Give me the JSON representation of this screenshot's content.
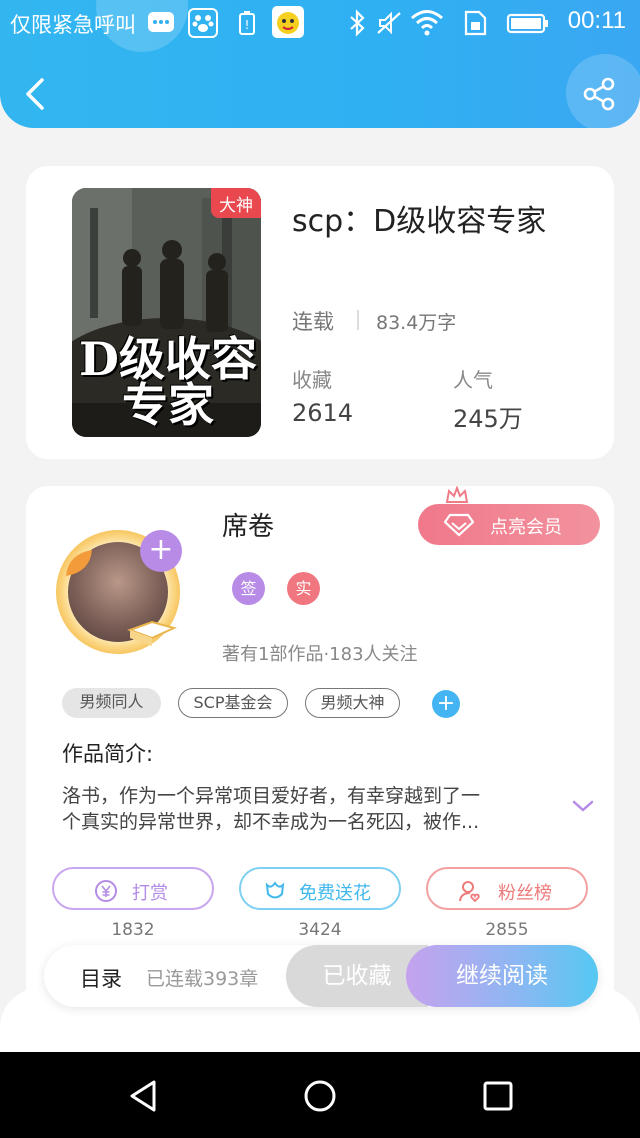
{
  "status_bar": {
    "carrier": "仅限紧急呼叫",
    "time": "00:11"
  },
  "header": {
    "back_icon": "chevron-left-icon",
    "share_icon": "share-icon"
  },
  "book": {
    "badge": "大神",
    "cover_title": "D级收容专家",
    "title": "scp：D级收容专家",
    "status": "连载",
    "word_count": "83.4万字",
    "stats": [
      {
        "label": "收藏",
        "value": "2614"
      },
      {
        "label": "人气",
        "value": "245万"
      }
    ]
  },
  "author": {
    "name": "席卷",
    "vip_button": "点亮会员",
    "badges": [
      {
        "label": "签",
        "color": "#b78be6"
      },
      {
        "label": "实",
        "color": "#f0777f"
      }
    ],
    "meta": "著有1部作品·183人关注",
    "tags": [
      "男频同人",
      "SCP基金会",
      "男频大神"
    ]
  },
  "intro": {
    "heading": "作品简介:",
    "line1": "洛书，作为一个异常项目爱好者，有幸穿越到了一",
    "line2": "个真实的异常世界，却不幸成为一名死囚，被作..."
  },
  "actions": [
    {
      "label": "打赏",
      "count": "1832",
      "icon": "yen-coin-icon",
      "color": "#b48be6"
    },
    {
      "label": "免费送花",
      "count": "3424",
      "icon": "flower-icon",
      "color": "#41b8ec"
    },
    {
      "label": "粉丝榜",
      "count": "2855",
      "icon": "fan-user-icon",
      "color": "#ee7a7a"
    }
  ],
  "bottom_bar": {
    "toc": "目录",
    "chapters": "已连载393章",
    "collected": "已收藏",
    "continue": "继续阅读"
  }
}
